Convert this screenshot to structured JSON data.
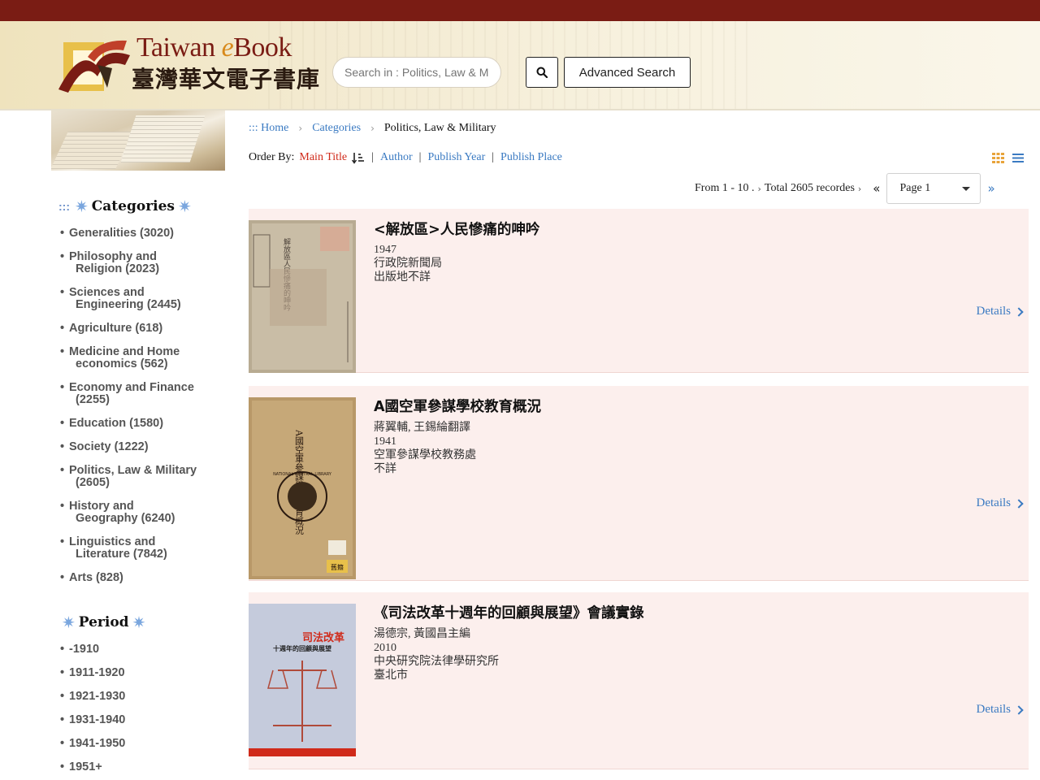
{
  "brand": {
    "name_en_prefix": "Taiwan ",
    "name_en_e": "e",
    "name_en_suffix": "Book",
    "name_zh": "臺灣華文電子書庫"
  },
  "search": {
    "placeholder": "Search in : Politics, Law & Military",
    "advanced_label": "Advanced Search"
  },
  "breadcrumb": {
    "home": "::: Home",
    "categories": "Categories",
    "current": "Politics, Law & Military"
  },
  "order": {
    "label": "Order By:",
    "active": "Main Title",
    "options": [
      "Author",
      "Publish Year",
      "Publish Place"
    ]
  },
  "pager": {
    "range": "From 1 - 10 .",
    "total": "Total 2605 recordes",
    "page": "Page 1"
  },
  "sidebar": {
    "categories_title": "Categories",
    "categories": [
      [
        "Generalities (3020)"
      ],
      [
        "Philosophy and",
        "Religion (2023)"
      ],
      [
        "Sciences and",
        "Engineering (2445)"
      ],
      [
        "Agriculture (618)"
      ],
      [
        "Medicine and Home",
        "economics (562)"
      ],
      [
        "Economy and Finance",
        "(2255)"
      ],
      [
        "Education (1580)"
      ],
      [
        "Society (1222)"
      ],
      [
        "Politics, Law & Military",
        "(2605)"
      ],
      [
        "History and",
        "Geography (6240)"
      ],
      [
        "Linguistics and",
        "Literature (7842)"
      ],
      [
        "Arts (828)"
      ]
    ],
    "period_title": "Period",
    "periods": [
      "-1910",
      "1911-1920",
      "1921-1930",
      "1931-1940",
      "1941-1950",
      "1951+"
    ]
  },
  "results": [
    {
      "title": "<解放區>人民慘痛的呻吟",
      "lines": [
        "1947",
        "行政院新聞局",
        "出版地不詳"
      ],
      "details": "Details"
    },
    {
      "title": "A國空軍參謀學校教育概況",
      "lines": [
        "蔣翼輔, 王錫綸翻譯",
        "1941",
        "空軍參謀學校教務處",
        "不詳"
      ],
      "details": "Details"
    },
    {
      "title": "《司法改革十週年的回顧與展望》會議實錄",
      "lines": [
        "湯德宗, 黃國昌主編",
        "2010",
        "中央研究院法律學研究所",
        "臺北市"
      ],
      "details": "Details"
    }
  ],
  "covers": {
    "cover1_title": "解放區人民慘痛的呻吟",
    "cover2_title": "A國空軍參謀學校教育概況",
    "cover2_seal": "NATIONAL CENTRAL LIBRARY",
    "cover2_stamp": "舊籍",
    "cover3_title": "司法改革",
    "cover3_sub": "十週年的回顧與展望"
  },
  "colors": {
    "topbar": "#7a1c14",
    "link": "#3a7ac2",
    "active_sort": "#d02a1a",
    "result_bg": "#fcefed"
  }
}
